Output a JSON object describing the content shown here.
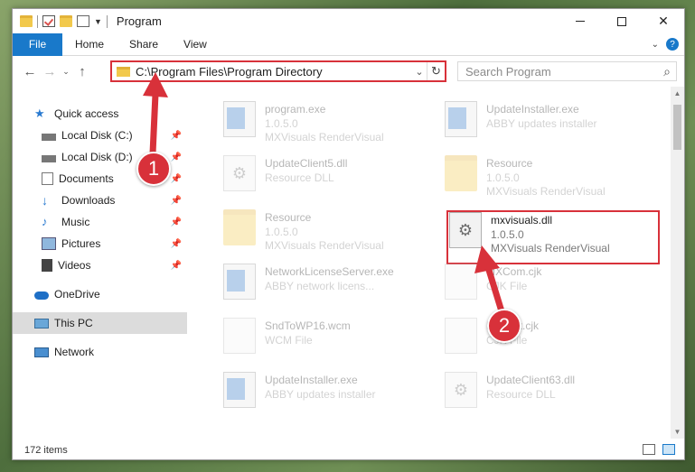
{
  "window": {
    "title": "Program"
  },
  "ribbon": {
    "tabs": [
      "File",
      "Home",
      "Share",
      "View"
    ]
  },
  "address": {
    "path": "C:\\Program Files\\Program Directory",
    "search_placeholder": "Search Program"
  },
  "nav": {
    "items": [
      {
        "label": "Quick access",
        "icon": "star-icon",
        "pinned": false
      },
      {
        "label": "Local Disk (C:)",
        "icon": "drive-icon",
        "pinned": true
      },
      {
        "label": "Local Disk (D:)",
        "icon": "drive-icon",
        "pinned": true
      },
      {
        "label": "Documents",
        "icon": "documents-icon",
        "pinned": true
      },
      {
        "label": "Downloads",
        "icon": "download-icon",
        "pinned": true
      },
      {
        "label": "Music",
        "icon": "music-icon",
        "pinned": true
      },
      {
        "label": "Pictures",
        "icon": "pictures-icon",
        "pinned": true
      },
      {
        "label": "Videos",
        "icon": "videos-icon",
        "pinned": true
      },
      {
        "label": "OneDrive",
        "icon": "cloud-icon",
        "pinned": false
      },
      {
        "label": "This PC",
        "icon": "computer-icon",
        "pinned": false
      },
      {
        "label": "Network",
        "icon": "network-icon",
        "pinned": false
      }
    ]
  },
  "files": [
    {
      "name": "program.exe",
      "line1": "1.0.5.0",
      "line2": "MXVisuals RenderVisual",
      "icon": "exe"
    },
    {
      "name": "UpdateInstaller.exe",
      "line1": "ABBY updates installer",
      "line2": "",
      "icon": "exe"
    },
    {
      "name": "UpdateClient5.dll",
      "line1": "Resource DLL",
      "line2": "",
      "icon": "gear"
    },
    {
      "name": "Resource",
      "line1": "1.0.5.0",
      "line2": "MXVisuals RenderVisual",
      "icon": "folder"
    },
    {
      "name": "Resource",
      "line1": "1.0.5.0",
      "line2": "MXVisuals RenderVisual",
      "icon": "folder"
    },
    {
      "name": "mxvisuals.dll",
      "line1": "1.0.5.0",
      "line2": "MXVisuals RenderVisual",
      "icon": "gear"
    },
    {
      "name": "NetworkLicenseServer.exe",
      "line1": "ABBY network licens...",
      "line2": "",
      "icon": "exe"
    },
    {
      "name": "MXCom.cjk",
      "line1": "CJK File",
      "line2": "",
      "icon": "doc"
    },
    {
      "name": "SndToWP16.wcm",
      "line1": "WCM File",
      "line2": "",
      "icon": "doc"
    },
    {
      "name": "Fontset.cjk",
      "line1": "CJK File",
      "line2": "",
      "icon": "doc"
    },
    {
      "name": "UpdateInstaller.exe",
      "line1": "ABBY updates installer",
      "line2": "",
      "icon": "exe"
    },
    {
      "name": "UpdateClient63.dll",
      "line1": "Resource DLL",
      "line2": "",
      "icon": "gear"
    }
  ],
  "status": {
    "item_count": "172 items"
  },
  "annotations": {
    "badge1": "1",
    "badge2": "2"
  },
  "colors": {
    "accent": "#1979ca",
    "highlight": "#d8313a"
  }
}
